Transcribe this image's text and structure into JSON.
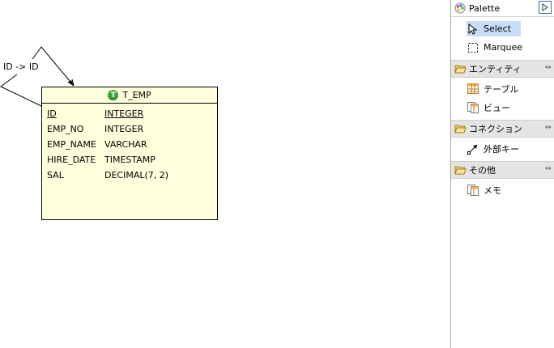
{
  "diagram": {
    "relationship_label": "ID -> ID",
    "entity": {
      "name": "T_EMP",
      "icon": "table-type-icon",
      "icon_letter": "T",
      "columns": [
        {
          "name": "ID",
          "type": "INTEGER",
          "primary_key": true
        },
        {
          "name": "EMP_NO",
          "type": "INTEGER",
          "primary_key": false
        },
        {
          "name": "EMP_NAME",
          "type": "VARCHAR",
          "primary_key": false
        },
        {
          "name": "HIRE_DATE",
          "type": "TIMESTAMP",
          "primary_key": false
        },
        {
          "name": "SAL",
          "type": "DECIMAL(7, 2)",
          "primary_key": false
        }
      ]
    }
  },
  "palette": {
    "title": "Palette",
    "tools": {
      "select_label": "Select",
      "marquee_label": "Marquee"
    },
    "drawers": {
      "entity": {
        "label": "エンティティ",
        "items": {
          "table": "テーブル",
          "view": "ビュー"
        }
      },
      "connection": {
        "label": "コネクション",
        "items": {
          "foreign_key": "外部キー"
        }
      },
      "other": {
        "label": "その他",
        "items": {
          "memo": "メモ"
        }
      }
    }
  },
  "colors": {
    "entity_fill": "#ffffdd",
    "selection": "#c9dcf7",
    "drawer_bg": "#e4e4e4",
    "table_icon": "#3fa63a"
  }
}
